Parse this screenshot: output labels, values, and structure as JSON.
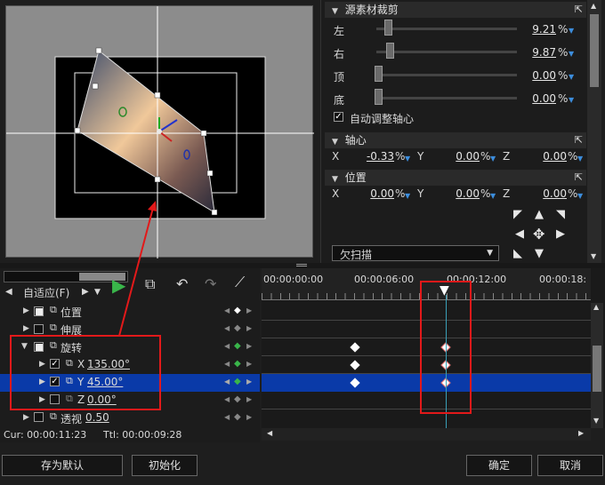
{
  "crop": {
    "title": "源素材裁剪",
    "rows": [
      {
        "label": "左",
        "value": "9.21",
        "unit": "%",
        "pos": 0.05
      },
      {
        "label": "右",
        "value": "9.87",
        "unit": "%",
        "pos": 0.07
      },
      {
        "label": "顶",
        "value": "0.00",
        "unit": "%",
        "pos": 0.0
      },
      {
        "label": "底",
        "value": "0.00",
        "unit": "%",
        "pos": 0.0
      }
    ],
    "auto_label": "自动调整轴心"
  },
  "pivot": {
    "title": "轴心",
    "x_label": "X",
    "x": "-0.33",
    "y_label": "Y",
    "y": "0.00",
    "z_label": "Z",
    "z": "0.00",
    "unit": "%"
  },
  "position": {
    "title": "位置",
    "x_label": "X",
    "x": "0.00",
    "y_label": "Y",
    "y": "0.00",
    "z_label": "Z",
    "z": "0.00",
    "unit": "%"
  },
  "scan_label": "欠扫描",
  "toolbar": {
    "fit_label": "自适应(F)"
  },
  "ruler": [
    "00:00:00:00",
    "00:00:06:00",
    "00:00:12:00",
    "00:00:18:"
  ],
  "tracks": [
    {
      "label": "位置",
      "value": ""
    },
    {
      "label": "伸展",
      "value": ""
    },
    {
      "label": "旋转",
      "value": ""
    },
    {
      "label": "X",
      "value": "135.00°"
    },
    {
      "label": "Y",
      "value": "45.00°"
    },
    {
      "label": "Z",
      "value": "0.00°"
    },
    {
      "label": "透视",
      "value": "0.50"
    }
  ],
  "status": {
    "cur": "Cur: 00:00:11:23",
    "ttl": "Ttl: 00:00:09:28"
  },
  "buttons": {
    "save_default": "存为默认",
    "init": "初始化",
    "ok": "确定",
    "cancel": "取消"
  },
  "colors": {
    "accent": "#0a3aa8",
    "highlight": "#e2191a",
    "play": "#39b54a"
  }
}
